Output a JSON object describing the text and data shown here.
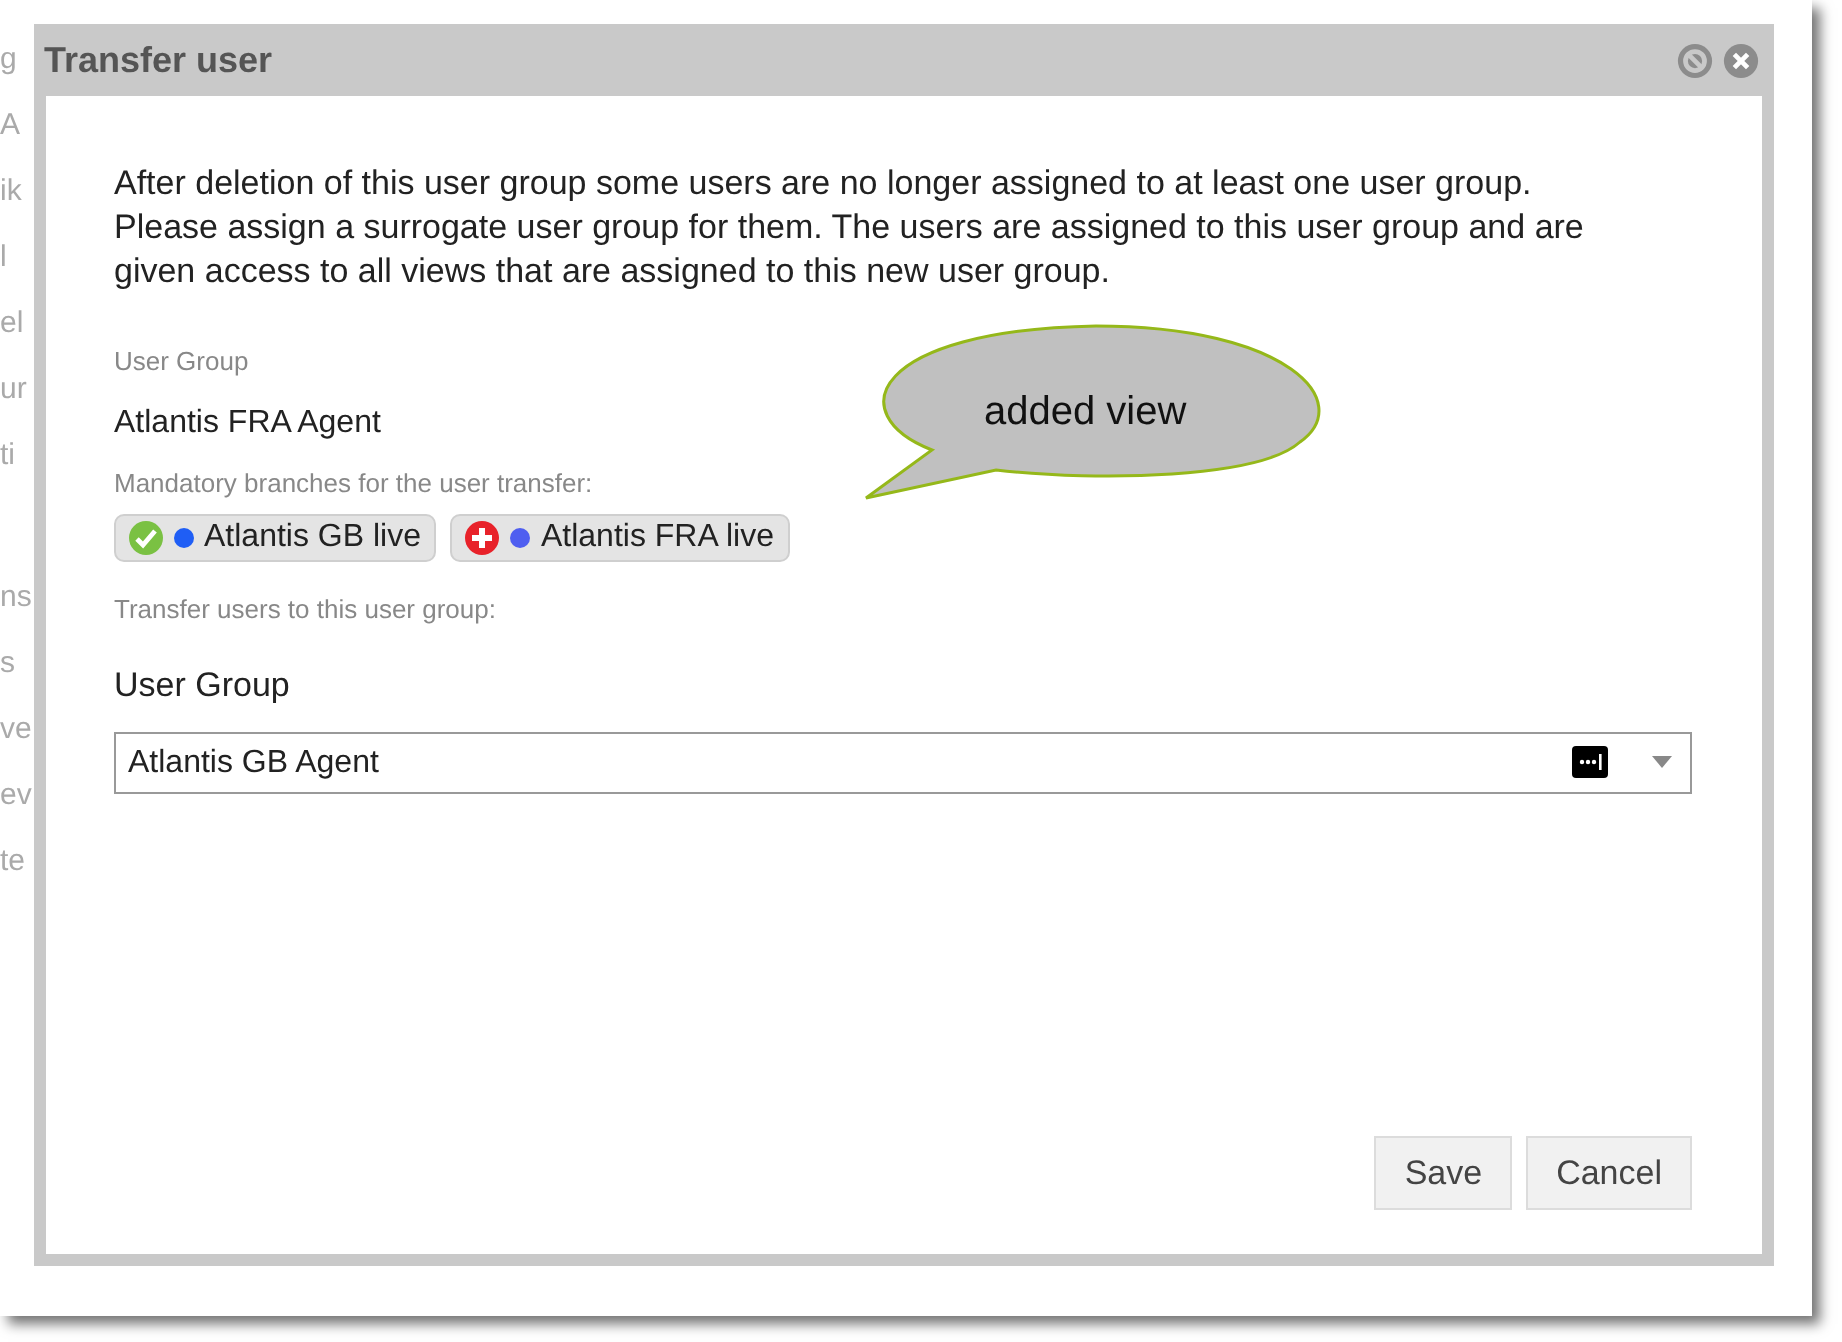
{
  "background_fragments": [
    "g",
    "A",
    "ik",
    "l",
    "el",
    "ur",
    "ti",
    "ns",
    "s",
    "ve",
    "ev",
    "te"
  ],
  "dialog": {
    "title": "Transfer user",
    "message": "After deletion of this user group some users are no longer assigned to at least one user group. Please assign a surrogate user group for them. The users are assigned to this user group and are given access to all views that are assigned to this new user group.",
    "source_label": "User Group",
    "source_value": "Atlantis FRA Agent",
    "branches_label": "Mandatory branches for the user transfer:",
    "branches": [
      {
        "kind": "ok",
        "label": "Atlantis GB live",
        "color": "#1f5ef5"
      },
      {
        "kind": "added",
        "label": "Atlantis FRA live",
        "color": "#4f5ef0"
      }
    ],
    "target_hint": "Transfer users to this user group:",
    "target_label": "User Group",
    "target_field": {
      "value": "Atlantis GB Agent"
    },
    "buttons": [
      "Save",
      "Cancel"
    ]
  },
  "callout": {
    "text": "added view"
  }
}
